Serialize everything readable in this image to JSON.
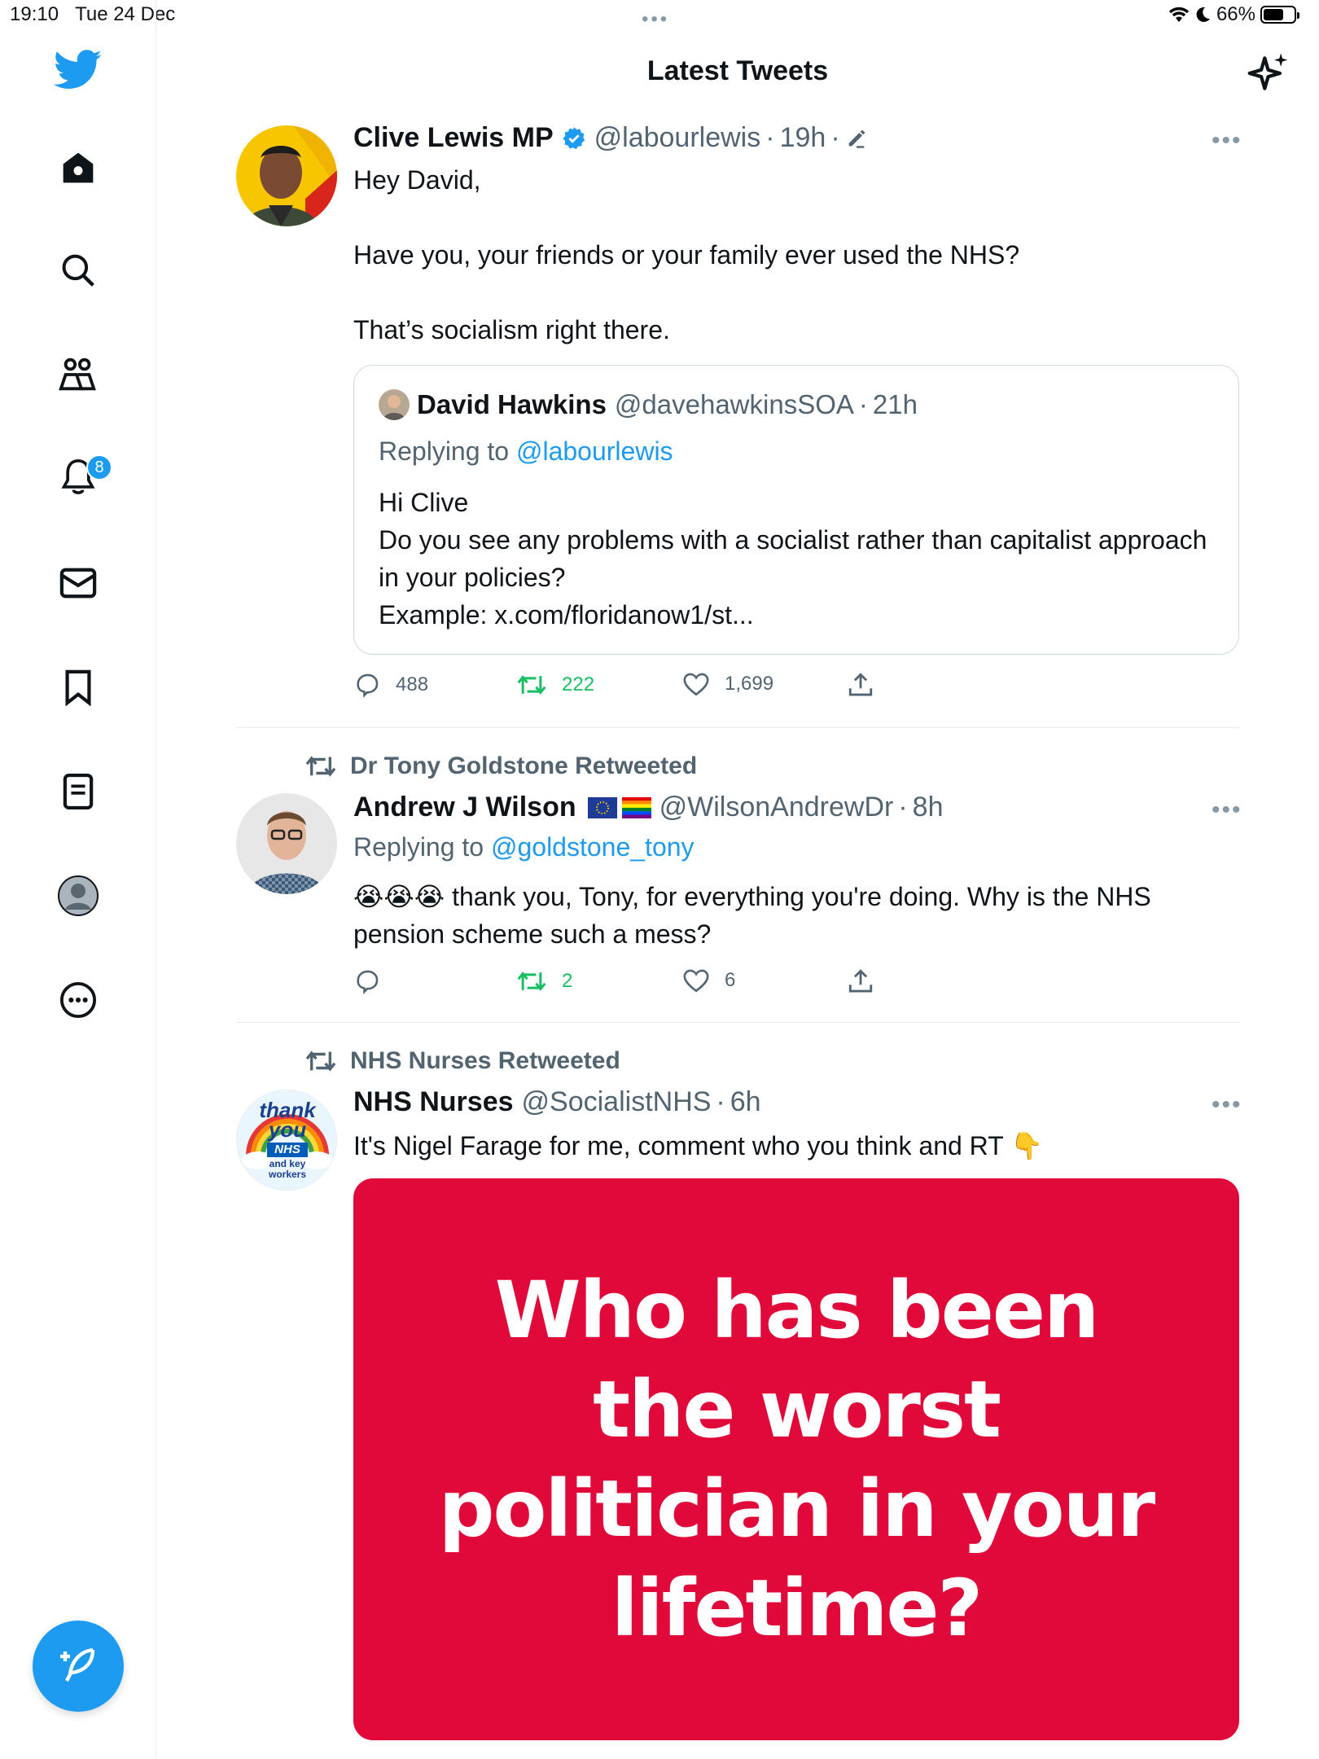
{
  "status_bar": {
    "time": "19:10",
    "date": "Tue 24 Dec",
    "battery": "66%",
    "battery_level": 0.66
  },
  "header": {
    "title": "Latest Tweets"
  },
  "sidebar": {
    "items": [
      {
        "icon": "home-icon"
      },
      {
        "icon": "search-icon"
      },
      {
        "icon": "communities-icon"
      },
      {
        "icon": "notifications-icon",
        "badge": "8"
      },
      {
        "icon": "messages-icon"
      },
      {
        "icon": "bookmarks-icon"
      },
      {
        "icon": "lists-icon"
      },
      {
        "icon": "profile-icon"
      },
      {
        "icon": "more-icon"
      }
    ]
  },
  "tweets": [
    {
      "name": "Clive Lewis MP",
      "handle": "@labourlewis",
      "time": "19h",
      "verified": true,
      "text": "Hey David,\n\nHave you, your friends or your family ever used the NHS?\n\nThat’s socialism right there.",
      "quote": {
        "name": "David Hawkins",
        "handle": "@davehawkinsSOA",
        "time": "21h",
        "replying_label": "Replying to",
        "replying_to": "@labourlewis",
        "text": "Hi Clive\nDo you see any problems with a socialist rather than capitalist approach in your policies?\nExample: x.com/floridanow1/st..."
      },
      "replies": "488",
      "retweets": "222",
      "likes": "1,699"
    },
    {
      "retweeted_by": "Dr Tony Goldstone Retweeted",
      "name": "Andrew J Wilson",
      "handle": "@WilsonAndrewDr",
      "time": "8h",
      "replying_label": "Replying to",
      "replying_to": "@goldstone_tony",
      "emojis": "😭😭😭",
      "text": "thank you, Tony, for everything you're doing. Why is the NHS pension scheme such a mess?",
      "replies": "",
      "retweets": "2",
      "likes": "6"
    },
    {
      "retweeted_by": "NHS Nurses Retweeted",
      "name": "NHS Nurses",
      "handle": "@SocialistNHS",
      "time": "6h",
      "text": "It's Nigel Farage for me, comment who you think and RT",
      "emoji": "👇",
      "avatar_text": {
        "line1": "thank",
        "line2": "you",
        "line3": "NHS",
        "line4": "and key",
        "line5": "workers"
      },
      "image_text": "Who has been the worst politician in your lifetime?",
      "image_color": "#e1093a"
    }
  ],
  "colors": {
    "accent": "#1d9bf0",
    "retweet": "#17bf63",
    "muted": "#536471"
  }
}
